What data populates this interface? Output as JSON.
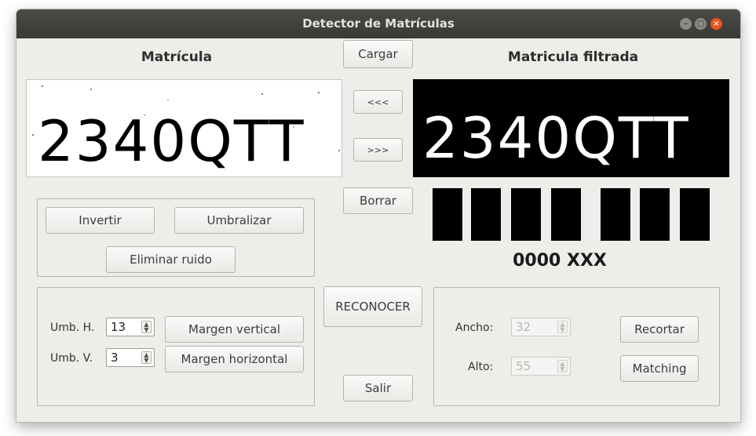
{
  "window": {
    "title": "Detector de Matrículas"
  },
  "left": {
    "heading": "Matrícula",
    "plate_text": "2340QTT",
    "buttons": {
      "invertir": "Invertir",
      "umbralizar": "Umbralizar",
      "eliminar_ruido": "Eliminar ruido",
      "margen_vertical": "Margen vertical",
      "margen_horizontal": "Margen horizontal"
    },
    "umb_h": {
      "label": "Umb. H.",
      "value": "13"
    },
    "umb_v": {
      "label": "Umb. V.",
      "value": "3"
    }
  },
  "center": {
    "cargar": "Cargar",
    "prev": "<<<",
    "next": ">>>",
    "borrar": "Borrar",
    "reconocer": "RECONOCER",
    "salir": "Salir"
  },
  "right": {
    "heading": "Matricula filtrada",
    "plate_text": "2340QTT",
    "result": "0000 XXX",
    "char_boxes": 7,
    "ancho": {
      "label": "Ancho:",
      "value": "32"
    },
    "alto": {
      "label": "Alto:",
      "value": "55"
    },
    "recortar": "Recortar",
    "matching": "Matching"
  },
  "colors": {
    "titlebar": "#3d3c38",
    "window_bg": "#efedea",
    "close_button": "#e95420"
  }
}
